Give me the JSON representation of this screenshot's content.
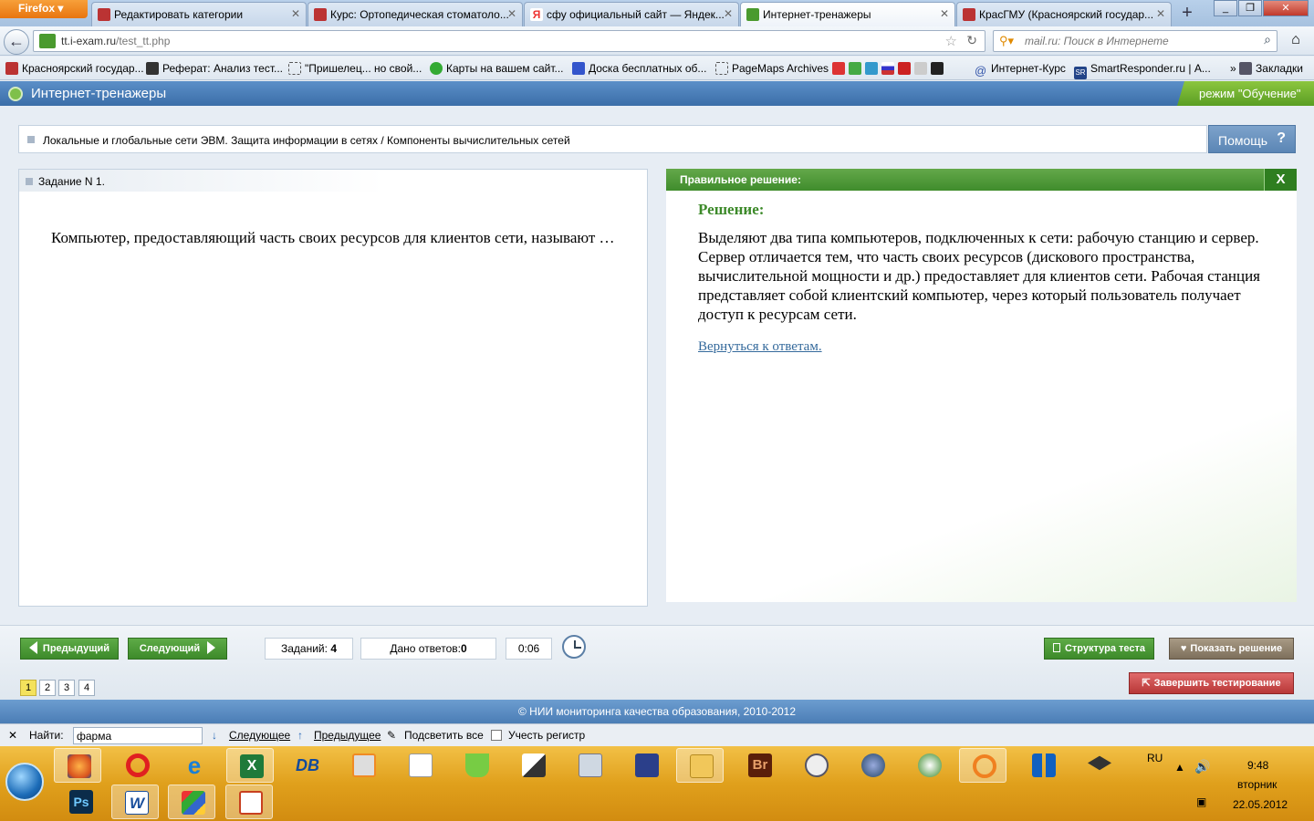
{
  "browser": {
    "menu_label": "Firefox",
    "tabs": [
      {
        "label": "Редактировать категории",
        "color": "#b33"
      },
      {
        "label": "Курс: Ортопедическая стоматоло...",
        "color": "#b33"
      },
      {
        "label": "сфу официальный сайт — Яндек...",
        "color": "#e33"
      },
      {
        "label": "Интернет-тренажеры",
        "color": "#4a9a2e"
      },
      {
        "label": "КрасГМУ (Красноярский государ...",
        "color": "#b33"
      }
    ],
    "new_tab": "+",
    "window_min": "_",
    "window_max": "❐",
    "window_close": "✕",
    "url_host": "tt.i-exam.ru",
    "url_path": "/test_tt.php",
    "search_placeholder": "mail.ru: Поиск в Интернете",
    "bookmarks": [
      "Красноярский государ...",
      "Реферат: Анализ тест...",
      "\"Пришелец... но свой...",
      "Карты на вашем сайт...",
      "Доска бесплатных об...",
      "PageMaps Archives",
      "Интернет-Курс",
      "SmartResponder.ru | А...",
      "Закладки"
    ]
  },
  "app": {
    "title": "Интернет-тренажеры",
    "mode": "режим \"Обучение\"",
    "breadcrumb": "Локальные и глобальные сети ЭВМ. Защита информации в сетях / Компоненты вычислительных сетей",
    "help_label": "Помощь",
    "help_icon": "?"
  },
  "question": {
    "header": "Задание N 1.",
    "text": "Компьютер, предоставляющий часть своих ресурсов для клиентов сети, называют …"
  },
  "solution": {
    "header": "Правильное решение:",
    "close": "X",
    "title": "Решение:",
    "body": "Выделяют два типа компьютеров, подключенных к сети: рабочую станцию и сервер. Сервер отличается тем, что часть своих ресурсов (дискового пространства, вычислительной мощности и др.) предоставляет для клиентов сети. Рабочая станция представляет собой клиентский компьютер, через который пользователь получает доступ к ресурсам сети.",
    "back_link": "Вернуться к ответам."
  },
  "controls": {
    "prev": "Предыдущий",
    "next": "Следующий",
    "tasks_label": "Заданий:",
    "tasks_value": "4",
    "answered_label": "Дано ответов:",
    "answered_value": "0",
    "timer": "0:06",
    "structure": "Структура теста",
    "show_solution": "Показать решение",
    "finish": "Завершить тестирование",
    "pages": [
      "1",
      "2",
      "3",
      "4"
    ],
    "current_page": "1"
  },
  "footer": {
    "copyright": "© НИИ мониторинга качества образования, 2010-2012"
  },
  "findbar": {
    "close": "✕",
    "label": "Найти:",
    "value": "фарма",
    "next": "Следующее",
    "prev": "Предыдущее",
    "highlight": "Подсветить все",
    "case": "Учесть регистр"
  },
  "taskbar": {
    "apps": [
      "firefox-icon",
      "opera-icon",
      "ie-icon",
      "excel-icon",
      "db-icon",
      "media-icon",
      "file-icon",
      "flask-icon",
      "pen-icon",
      "calculator-icon",
      "save-icon",
      "explorer-icon",
      "bridge-icon",
      "mouse-icon",
      "globe-icon",
      "app-icon",
      "rss-icon",
      "grid-icon",
      "graduation-icon",
      "photoshop-icon",
      "word-icon",
      "windows-icon",
      "powerpoint-icon"
    ],
    "lang": "RU",
    "time": "9:48",
    "day": "вторник",
    "date": "22.05.2012"
  }
}
